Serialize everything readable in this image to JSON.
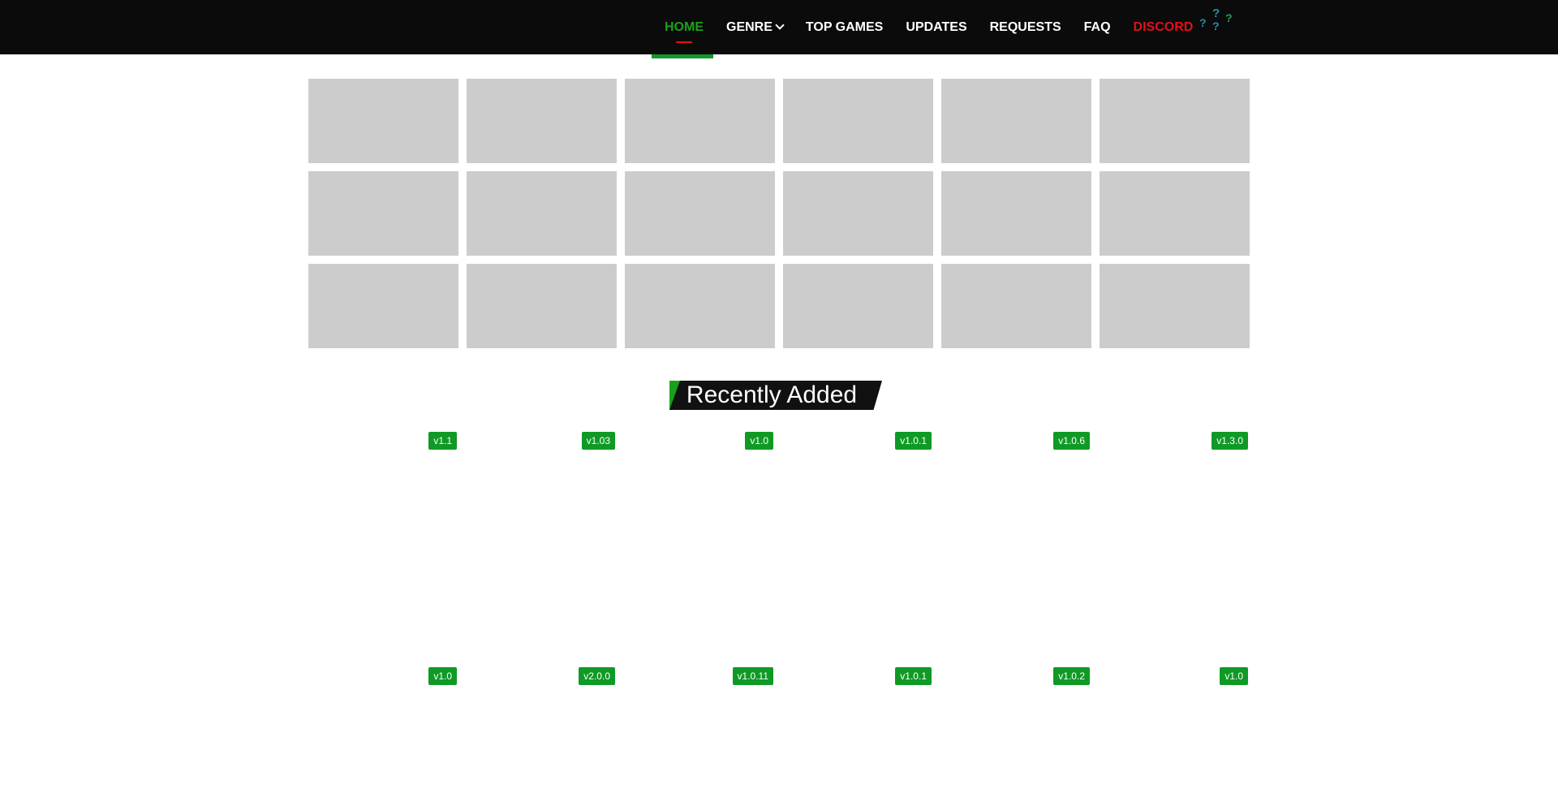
{
  "nav": {
    "items": [
      {
        "label": "HOME",
        "active": true
      },
      {
        "label": "GENRE",
        "has_dropdown": true
      },
      {
        "label": "TOP GAMES"
      },
      {
        "label": "UPDATES"
      },
      {
        "label": "REQUESTS"
      },
      {
        "label": "FAQ"
      },
      {
        "label": "DISCORD",
        "color": "#e0101a"
      }
    ],
    "icons": [
      "?",
      "?",
      "?",
      "?"
    ]
  },
  "colors": {
    "topbar": "#0b0b0b",
    "accent_green": "#1aa11a",
    "badge_green": "#0f9a25",
    "tile_placeholder": "#cccccc"
  },
  "featured_grid": {
    "rows": 3,
    "columns": 6
  },
  "recently_added": {
    "title": "Recently Added",
    "row1_versions": [
      "v1.1",
      "v1.03",
      "v1.0",
      "v1.0.1",
      "v1.0.6",
      "v1.3.0"
    ],
    "row2_versions": [
      "v1.0",
      "v2.0.0",
      "v1.0.11",
      "v1.0.1",
      "v1.0.2",
      "v1.0"
    ]
  }
}
